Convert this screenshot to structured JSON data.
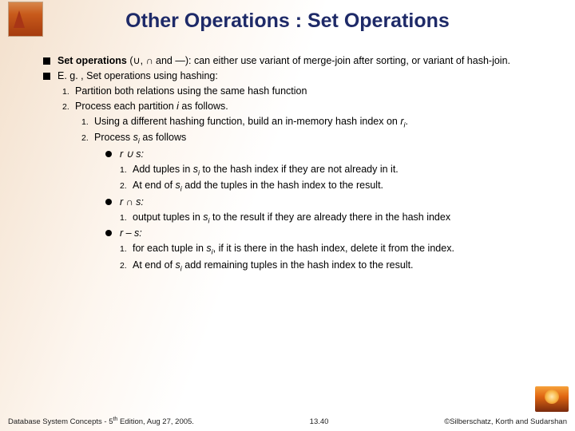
{
  "title": "Other Operations : Set Operations",
  "bullets": {
    "b1_lead": "Set operations",
    "b1_paren": "(∪, ∩ and —):",
    "b1_rest": "  can either use variant of merge-join after sorting, or variant of hash-join.",
    "b2": "E. g. , Set operations using hashing:",
    "s1": "Partition both relations using the same hash function",
    "s2_a": "Process each partition ",
    "s2_b": " as follows.",
    "s2_i": "i",
    "s21_a": "Using a different hashing function, build an in-memory hash index on ",
    "s21_r": "r",
    "s21_c": ".",
    "s22_a": "Process ",
    "s22_s": "s",
    "s22_b": " as follows",
    "case1": "r ∪ s:",
    "c1_1a": "Add tuples in ",
    "c1_1b": " to the hash index if they are not already in it.",
    "c1_2a": "At end of ",
    "c1_2b": " add the tuples in the hash index to the result.",
    "case2": "r ∩ s:",
    "c2_1a": "output tuples in ",
    "c2_1b": " to the result if they are already there in the hash index",
    "case3": "r – s:",
    "c3_1a": "for each tuple in ",
    "c3_1b": ", if it is there in the hash index, delete it from the index.",
    "c3_2a": " At end of ",
    "c3_2b": " add remaining tuples in the hash index to the result.",
    "si": "s",
    "ii": "i"
  },
  "footer": {
    "left_a": "Database System Concepts - 5",
    "left_sup": "th",
    "left_b": " Edition, Aug 27, 2005.",
    "center": "13.40",
    "right": "©Silberschatz, Korth and Sudarshan"
  }
}
